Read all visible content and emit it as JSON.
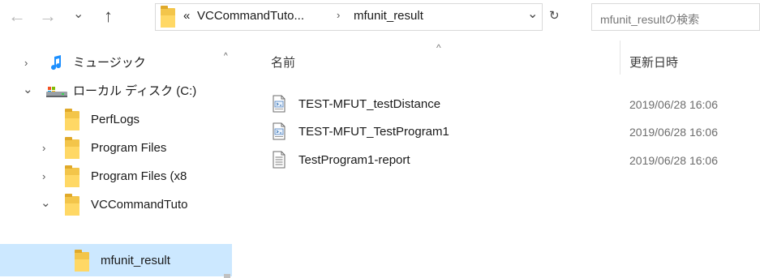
{
  "toolbar": {
    "back_glyph": "←",
    "forward_glyph": "→",
    "recent_glyph": "⌄",
    "up_glyph": "↑"
  },
  "address": {
    "overflow_glyph": "«",
    "crumbs": [
      "VCCommandTuto...",
      "mfunit_result"
    ],
    "separator_glyph": "›",
    "dropdown_glyph": "⌄",
    "refresh_glyph": "↻"
  },
  "search": {
    "placeholder": "mfunit_resultの検索"
  },
  "tree": {
    "items": [
      {
        "label": "ミュージック",
        "chevron": "›",
        "icon": "music-icon"
      },
      {
        "label": "ローカル ディスク (C:)",
        "chevron": "⌄",
        "icon": "drive-icon"
      },
      {
        "label": "PerfLogs",
        "chevron": "",
        "icon": "folder-icon"
      },
      {
        "label": "Program Files",
        "chevron": "›",
        "icon": "folder-icon"
      },
      {
        "label": "Program Files (x8",
        "chevron": "›",
        "icon": "folder-icon"
      },
      {
        "label": "VCCommandTuto",
        "chevron": "⌄",
        "icon": "folder-icon"
      },
      {
        "label": "mfunit_result",
        "chevron": "",
        "icon": "folder-icon"
      }
    ],
    "scroll_up_glyph": "^"
  },
  "columns": {
    "name": "名前",
    "date": "更新日時",
    "sort_glyph": "^"
  },
  "files": [
    {
      "name": "TEST-MFUT_testDistance",
      "date": "2019/06/28 16:06",
      "icon": "xml-document-icon"
    },
    {
      "name": "TEST-MFUT_TestProgram1",
      "date": "2019/06/28 16:06",
      "icon": "xml-document-icon"
    },
    {
      "name": "TestProgram1-report",
      "date": "2019/06/28 16:06",
      "icon": "text-document-icon"
    }
  ],
  "colors": {
    "selection": "#cce8ff",
    "folder": "#ffd865",
    "accent": "#0078d7"
  }
}
